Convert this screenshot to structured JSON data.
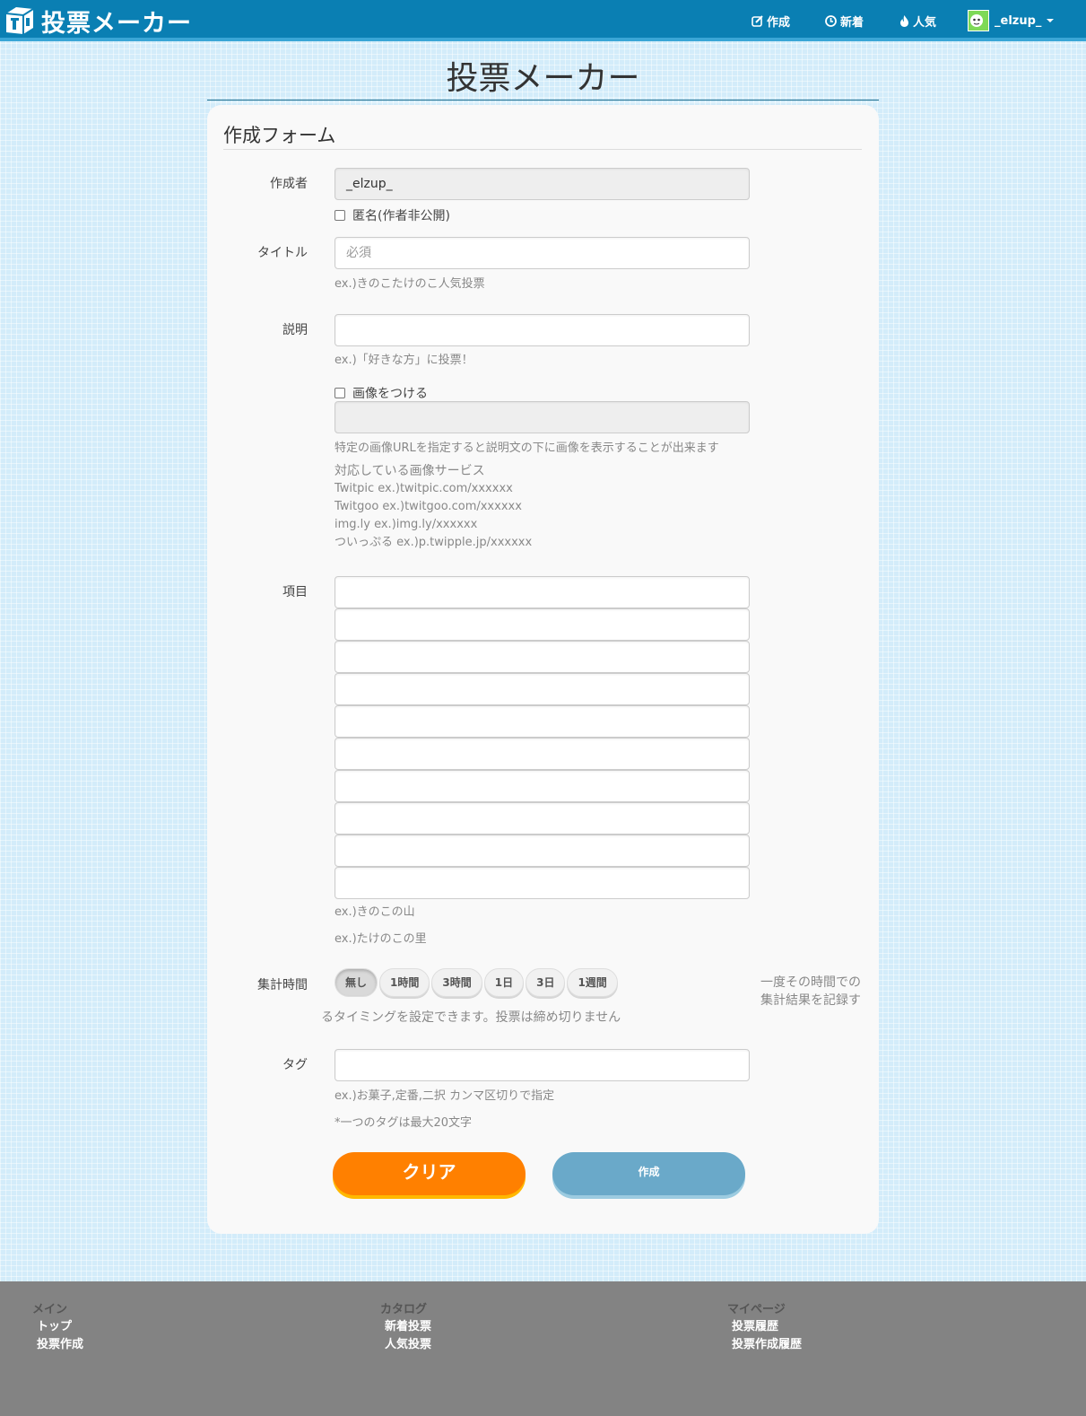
{
  "nav": {
    "brand": "投票メーカー",
    "create": "作成",
    "new": "新着",
    "popular": "人気",
    "user": "_elzup_"
  },
  "page": {
    "title": "投票メーカー"
  },
  "form": {
    "heading": "作成フォーム",
    "author": {
      "label": "作成者",
      "value": "_elzup_",
      "anonymous_label": "匿名(作者非公開)"
    },
    "title_field": {
      "label": "タイトル",
      "placeholder": "必須",
      "help": "ex.)きのこたけのこ人気投票"
    },
    "description": {
      "label": "説明",
      "value": "",
      "help": "ex.)「好きな方」に投票！"
    },
    "image": {
      "checkbox_label": "画像をつける",
      "help": "特定の画像URLを指定すると説明文の下に画像を表示することが出来ます",
      "services_heading": "対応している画像サービス",
      "services": [
        "Twitpic ex.)twitpic.com/xxxxxx",
        "Twitgoo ex.)twitgoo.com/xxxxxx",
        "img.ly ex.)img.ly/xxxxxx",
        "ついっぷる ex.)p.twipple.jp/xxxxxx"
      ]
    },
    "items": {
      "label": "項目",
      "help1": "ex.)きのこの山",
      "help2": "ex.)たけのこの里"
    },
    "period": {
      "label": "集計時間",
      "options": [
        "無し",
        "1時間",
        "3時間",
        "1日",
        "3日",
        "1週間"
      ],
      "selected": "無し",
      "note_line1": "一度その時間での",
      "note_line2": "集計結果を記録す",
      "note_line3": "るタイミングを設定できます。投票は締め切りません"
    },
    "tags": {
      "label": "タグ",
      "help1": "ex.)お菓子,定番,二択 カンマ区切りで指定",
      "help2": "*一つのタグは最大20文字"
    },
    "buttons": {
      "clear": "クリア",
      "create": "作成"
    }
  },
  "footer": {
    "main": {
      "heading": "メイン",
      "links": [
        "トップ",
        "投票作成"
      ]
    },
    "catalog": {
      "heading": "カタログ",
      "links": [
        "新着投票",
        "人気投票"
      ]
    },
    "mypage": {
      "heading": "マイページ",
      "links": [
        "投票履歴",
        "投票作成履歴"
      ]
    }
  },
  "colors": {
    "navbar": "#0a7fb3",
    "background": "#d3ecfa",
    "clear_button": "#ff8000",
    "create_button": "#6aa9c9",
    "footer": "#838383"
  }
}
